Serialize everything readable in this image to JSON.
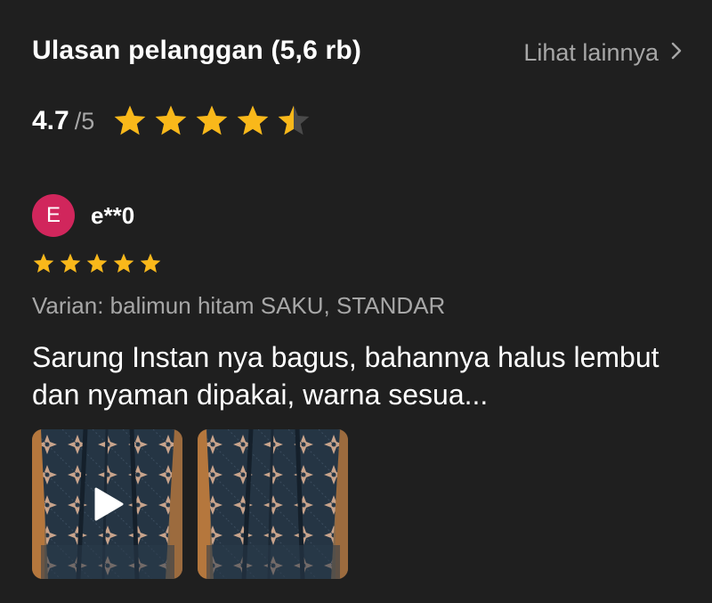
{
  "header": {
    "title": "Ulasan pelanggan (5,6 rb)",
    "see_more_label": "Lihat lainnya",
    "see_more_icon": "chevron-right-icon"
  },
  "rating": {
    "value": "4.7",
    "max": "/5",
    "stars_filled": 4.5,
    "star_color": "#f9b81a"
  },
  "review": {
    "avatar_initial": "E",
    "avatar_color": "#d1265c",
    "reviewer_name": "e**0",
    "stars": 5,
    "variant": "Varian: balimun hitam SAKU, STANDAR",
    "text": "Sarung Instan nya bagus, bahannya halus lembut dan nyaman dipakai, warna sesua...",
    "media": [
      {
        "type": "video",
        "icon": "play-icon"
      },
      {
        "type": "photo"
      }
    ]
  }
}
